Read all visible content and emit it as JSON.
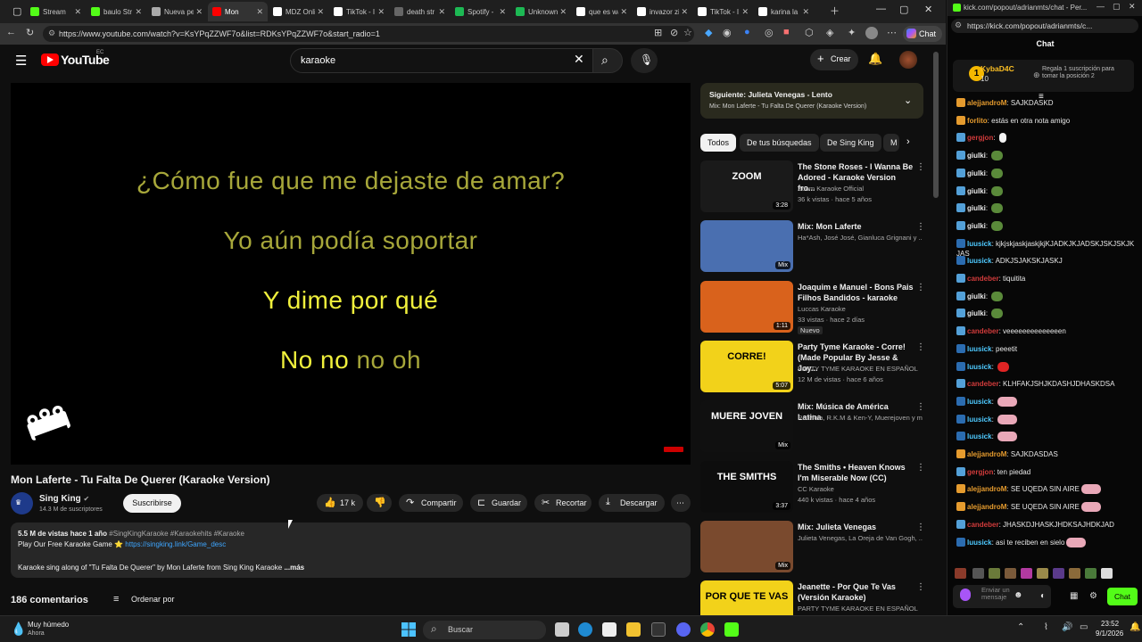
{
  "browser": {
    "tabs": [
      {
        "label": "Stream",
        "color": "#53fc18"
      },
      {
        "label": "baulo Str",
        "color": "#53fc18"
      },
      {
        "label": "Nueva pe",
        "color": "#aaaaaa"
      },
      {
        "label": "Mon",
        "color": "#ff0000"
      },
      {
        "label": "MDZ Onli",
        "color": "#ffffff"
      },
      {
        "label": "TikTok - I",
        "color": "#ffffff"
      },
      {
        "label": "death str",
        "color": "#666666"
      },
      {
        "label": "Spotify -",
        "color": "#1db954"
      },
      {
        "label": "Unknown",
        "color": "#1db954"
      },
      {
        "label": "que es wa",
        "color": "#ffffff"
      },
      {
        "label": "invazor zi",
        "color": "#ffffff"
      },
      {
        "label": "TikTok - I",
        "color": "#ffffff"
      },
      {
        "label": "karina la",
        "color": "#ffffff"
      }
    ],
    "url": "https://www.youtube.com/watch?v=KsYPqZZWF7o&list=RDKsYPqZZWF7o&start_radio=1",
    "chat_button": "Chat"
  },
  "youtube": {
    "logo_text": "YouTube",
    "logo_country": "EC",
    "search_value": "karaoke",
    "create_label": "Crear",
    "lyrics": [
      {
        "text": "¿Cómo fue que me dejaste de amar?",
        "color": "#a7a73a"
      },
      {
        "text": "Yo aún podía soportar",
        "color": "#a7a73a"
      },
      {
        "text": "Y dime por qué",
        "color": "#f0f03c"
      },
      {
        "text_a": "No no",
        "text_b": "no oh",
        "color": "#f0f03c",
        "color_b": "#a7a73a"
      }
    ],
    "watermark": "SING KING",
    "video_title": "Mon Laferte - Tu Falta De Querer (Karaoke Version)",
    "channel_name": "Sing King",
    "subscribers": "14.3 M de suscriptores",
    "subscribe_label": "Suscribirse",
    "likes": "17 k",
    "actions": [
      "Compartir",
      "Guardar",
      "Recortar",
      "Descargar"
    ],
    "desc_stats": "5.5 M de vistas  hace 1 año",
    "desc_tags": "#SingKingKaraoke #Karaokehits #Karaoke",
    "desc_line2": "Play Our Free Karaoke Game",
    "desc_link": "https://singking.link/Game_desc",
    "desc_line3": "Karaoke sing along of \"Tu Falta De Querer\" by Mon Laferte from Sing King Karaoke",
    "desc_more": "...más",
    "comments_count": "186 comentarios",
    "sort_label": "Ordenar por",
    "playlist_title": "Siguiente: Julieta Venegas - Lento",
    "playlist_sub": "Mix: Mon Laferte - Tu Falta De Querer (Karaoke Version)",
    "chips": [
      "Todos",
      "De tus búsquedas",
      "De Sing King",
      "M"
    ],
    "recommendations": [
      {
        "title": "The Stone Roses - I Wanna Be Adored - Karaoke Version fro...",
        "channel": "Zoom Karaoke Official",
        "meta": "36 k vistas · hace 5 años",
        "duration": "3:28",
        "thumb": "#1a1a1a",
        "thumb_text": "ZOOM"
      },
      {
        "title": "Mix: Mon Laferte",
        "channel": "Ha*Ash, José José, Gianluca Grignani y ...",
        "meta": "",
        "duration": "Mix",
        "thumb": "#4a6fb0",
        "thumb_text": ""
      },
      {
        "title": "Joaquim e Manuel - Bons Pais Filhos Bandidos - karaoke",
        "channel": "Luccas Karaoke",
        "meta": "33 vistas · hace 2 días",
        "duration": "1:11",
        "thumb": "#d9621c",
        "thumb_text": "",
        "badge": "Nuevo"
      },
      {
        "title": "Party Tyme Karaoke - Corre! (Made Popular By Jesse & Joy...",
        "channel": "PARTY TYME KARAOKE EN ESPAÑOL",
        "meta": "12 M de vistas · hace 6 años",
        "duration": "5:07",
        "thumb": "#f2d21a",
        "thumb_text": "CORRE!"
      },
      {
        "title": "Mix: Música de América Latina",
        "channel": "Re Piola, R.K.M & Ken-Y, Muerejoven y m...",
        "meta": "",
        "duration": "Mix",
        "thumb": "#101010",
        "thumb_text": "MUERE JOVEN"
      },
      {
        "title": "The Smiths • Heaven Knows I'm Miserable Now (CC)",
        "channel": "CC Karaoke",
        "meta": "440 k vistas · hace 4 años",
        "duration": "3:37",
        "thumb": "#0d0d0d",
        "thumb_text": "THE SMITHS"
      },
      {
        "title": "Mix: Julieta Venegas",
        "channel": "Julieta Venegas, La Oreja de Van Gogh, ...",
        "meta": "",
        "duration": "Mix",
        "thumb": "#7a4a2e",
        "thumb_text": ""
      },
      {
        "title": "Jeanette - Por Que Te Vas (Versión Karaoke)",
        "channel": "PARTY TYME KARAOKE EN ESPAÑOL",
        "meta": "",
        "duration": "",
        "thumb": "#f2d21a",
        "thumb_text": "POR QUE TE VAS"
      }
    ]
  },
  "kick": {
    "url": "https://kick.com/popout/adrianmts/c...",
    "title_url": "kick.com/popout/adrianmts/chat - Per...",
    "header": "Chat",
    "gifter_name": "KybaD4C",
    "gifter_count": "10",
    "gift_text": "Regala 1 suscripción para tomar la posición 2",
    "messages": [
      {
        "user": "alejjandroM",
        "text": "SAJKDASKD",
        "color": "#e59b2e"
      },
      {
        "user": "forlito",
        "text": "estás en otra nota amigo",
        "color": "#e59b2e"
      },
      {
        "user": "gergjon",
        "text": "",
        "color": "#d13b3b",
        "emote": "hand"
      },
      {
        "user": "giulki",
        "text": "",
        "color": "#e8e8e8",
        "emote": "green"
      },
      {
        "user": "giulki",
        "text": "",
        "color": "#e8e8e8",
        "emote": "green"
      },
      {
        "user": "giulki",
        "text": "",
        "color": "#e8e8e8",
        "emote": "green"
      },
      {
        "user": "giulki",
        "text": "",
        "color": "#e8e8e8",
        "emote": "green"
      },
      {
        "user": "giulki",
        "text": "",
        "color": "#e8e8e8",
        "emote": "green"
      },
      {
        "user": "luusick",
        "text": "kjkjskjaskjaskjkjKJADKJKJADSKJSKJSKJKJAS",
        "color": "#4ec9ff"
      },
      {
        "user": "luusick",
        "text": "ADKJSJAKSKJASKJ",
        "color": "#4ec9ff"
      },
      {
        "user": "candeber",
        "text": "tiquitita",
        "color": "#d13b3b"
      },
      {
        "user": "giulki",
        "text": "",
        "color": "#e8e8e8",
        "emote": "green"
      },
      {
        "user": "giulki",
        "text": "",
        "color": "#e8e8e8",
        "emote": "green"
      },
      {
        "user": "candeber",
        "text": "veeeeeeeeeeeeeen",
        "color": "#d13b3b"
      },
      {
        "user": "luusick",
        "text": "peeetit",
        "color": "#4ec9ff"
      },
      {
        "user": "luusick",
        "text": "",
        "color": "#4ec9ff",
        "emote": "red"
      },
      {
        "user": "candeber",
        "text": "KLHFAKJSHJKDASHJDHASKDSA",
        "color": "#d13b3b"
      },
      {
        "user": "luusick",
        "text": "",
        "color": "#4ec9ff",
        "emote": "pink"
      },
      {
        "user": "luusick",
        "text": "",
        "color": "#4ec9ff",
        "emote": "pink"
      },
      {
        "user": "luusick",
        "text": "",
        "color": "#4ec9ff",
        "emote": "pink"
      },
      {
        "user": "alejjandroM",
        "text": "SAJKDASDAS",
        "color": "#e59b2e"
      },
      {
        "user": "gergjon",
        "text": "ten piedad",
        "color": "#d13b3b"
      },
      {
        "user": "alejjandroM",
        "text": "SE UQEDA SIN AIRE",
        "color": "#e59b2e",
        "emote": "pink"
      },
      {
        "user": "alejjandroM",
        "text": "SE UQEDA SIN AIRE",
        "color": "#e59b2e",
        "emote": "pink"
      },
      {
        "user": "candeber",
        "text": "JHASKDJHASKJHDKSAJHDKJAD",
        "color": "#d13b3b"
      },
      {
        "user": "luusick",
        "text": "asi te reciben en sielo",
        "color": "#4ec9ff",
        "emote": "pink"
      }
    ],
    "input_placeholder": "Enviar un mensaje",
    "send_label": "Chat"
  },
  "taskbar": {
    "weather_title": "Muy húmedo",
    "weather_sub": "Ahora",
    "search_label": "Buscar",
    "time": "23:52",
    "date": "9/1/2026"
  }
}
